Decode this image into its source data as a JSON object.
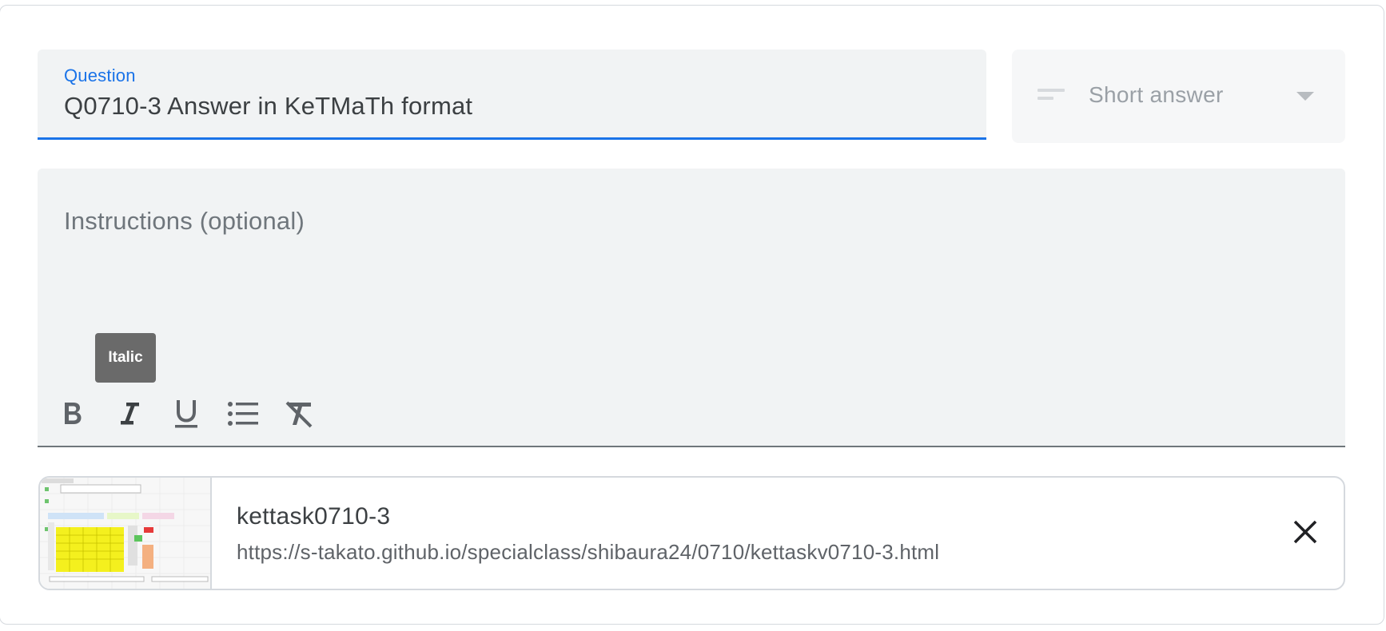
{
  "question": {
    "label": "Question",
    "value": "Q0710-3 Answer in KeTMaTh format"
  },
  "type_select": {
    "icon": "short-text-icon",
    "selected": "Short answer"
  },
  "instructions": {
    "placeholder": "Instructions (optional)",
    "tooltip": "Italic",
    "toolbar": [
      {
        "name": "bold",
        "icon": "bold-icon"
      },
      {
        "name": "italic",
        "icon": "italic-icon"
      },
      {
        "name": "underline",
        "icon": "underline-icon"
      },
      {
        "name": "bulleted-list",
        "icon": "bulleted-list-icon"
      },
      {
        "name": "clear-formatting",
        "icon": "clear-formatting-icon"
      }
    ]
  },
  "attachment": {
    "title": "kettask0710-3",
    "url": "https://s-takato.github.io/specialclass/shibaura24/0710/kettaskv0710-3.html",
    "close_icon": "close-icon"
  },
  "colors": {
    "accent": "#1a73e8",
    "field_bg": "#f1f3f4",
    "tooltip_bg": "#6a6a6a"
  }
}
